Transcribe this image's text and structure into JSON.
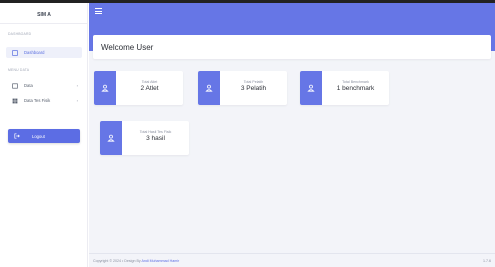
{
  "brand": "SIM A",
  "sidebar": {
    "section_dashboard": "DASHBOARD",
    "dashboard_label": "Dashboard",
    "section_data": "MENU DATA",
    "items": [
      {
        "label": "Data"
      },
      {
        "label": "Data Tes Fisik"
      }
    ],
    "logout_label": "Logout"
  },
  "main": {
    "welcome": "Welcome User"
  },
  "stats": [
    {
      "label": "Total Atlet",
      "value": "2 Atlet"
    },
    {
      "label": "Total Pelatih",
      "value": "3 Pelatih"
    },
    {
      "label": "Total Benchmark",
      "value": "1 benchmark"
    },
    {
      "label": "Total Hasil Tes Fisik",
      "value": "3 hasil"
    }
  ],
  "footer": {
    "copyright": "Copyright © 2024 • Design By",
    "author": "Andi Muhammad Hamir",
    "version": "1.7.6"
  },
  "colors": {
    "accent": "#6676e6",
    "button": "#5c6de4",
    "background": "#f3f4f9"
  }
}
